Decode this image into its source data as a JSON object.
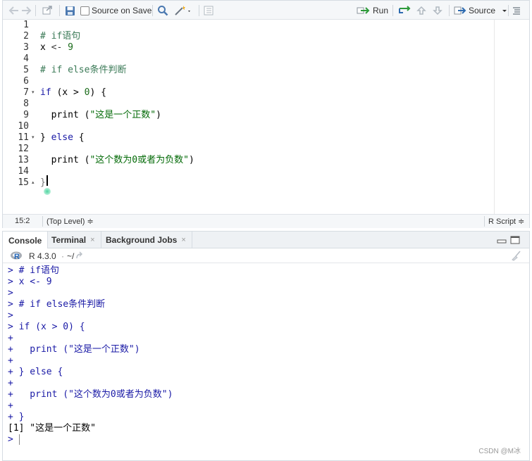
{
  "editor": {
    "toolbar": {
      "source_on_save_label": "Source on Save",
      "run_label": "Run",
      "source_label": "Source"
    },
    "lines": [
      {
        "num": "1",
        "fold": ""
      },
      {
        "num": "2",
        "fold": ""
      },
      {
        "num": "3",
        "fold": ""
      },
      {
        "num": "4",
        "fold": ""
      },
      {
        "num": "5",
        "fold": ""
      },
      {
        "num": "6",
        "fold": ""
      },
      {
        "num": "7",
        "fold": "▾"
      },
      {
        "num": "8",
        "fold": ""
      },
      {
        "num": "9",
        "fold": ""
      },
      {
        "num": "10",
        "fold": ""
      },
      {
        "num": "11",
        "fold": "▾"
      },
      {
        "num": "12",
        "fold": ""
      },
      {
        "num": "13",
        "fold": ""
      },
      {
        "num": "14",
        "fold": ""
      },
      {
        "num": "15",
        "fold": "▴"
      }
    ],
    "code": {
      "l2": "# if语句",
      "l3_a": "x",
      "l3_b": " <- ",
      "l3_c": "9",
      "l5": "# if else条件判断",
      "l7_kw": "if",
      "l7_a": " (x > ",
      "l7_num": "0",
      "l7_b": ") {",
      "l9_fn": "  print (",
      "l9_str": "\"这是一个正数\"",
      "l9_end": ")",
      "l11_a": "} ",
      "l11_kw": "else",
      "l11_b": " {",
      "l13_fn": "  print (",
      "l13_str": "\"这个数为0或者为负数\"",
      "l13_end": ")",
      "l15": "}"
    },
    "status": {
      "position": "15:2",
      "scope": "(Top Level) ≑",
      "filetype": "R Script ≑"
    }
  },
  "console": {
    "tabs": [
      {
        "label": "Console",
        "closable": false
      },
      {
        "label": "Terminal",
        "closable": true
      },
      {
        "label": "Background Jobs",
        "closable": true
      }
    ],
    "close_glyph": "×",
    "r_version": "R 4.3.0",
    "working_dir": "~/",
    "lines": [
      {
        "prompt": ">",
        "text": " # if语句",
        "kind": "in"
      },
      {
        "prompt": ">",
        "text": " x <- 9",
        "kind": "in"
      },
      {
        "prompt": ">",
        "text": "",
        "kind": "in"
      },
      {
        "prompt": ">",
        "text": " # if else条件判断",
        "kind": "in"
      },
      {
        "prompt": ">",
        "text": "",
        "kind": "in"
      },
      {
        "prompt": ">",
        "text": " if (x > 0) {",
        "kind": "in"
      },
      {
        "prompt": "+",
        "text": "",
        "kind": "in"
      },
      {
        "prompt": "+",
        "text": "   print (\"这是一个正数\")",
        "kind": "in"
      },
      {
        "prompt": "+",
        "text": "",
        "kind": "in"
      },
      {
        "prompt": "+",
        "text": " } else {",
        "kind": "in"
      },
      {
        "prompt": "+",
        "text": "",
        "kind": "in"
      },
      {
        "prompt": "+",
        "text": "   print (\"这个数为0或者为负数\")",
        "kind": "in"
      },
      {
        "prompt": "+",
        "text": "",
        "kind": "in"
      },
      {
        "prompt": "+",
        "text": " }",
        "kind": "in"
      },
      {
        "prompt": "",
        "text": "[1] \"这是一个正数\"",
        "kind": "out"
      },
      {
        "prompt": ">",
        "text": "",
        "kind": "in"
      }
    ]
  },
  "watermark": "CSDN @M冰"
}
